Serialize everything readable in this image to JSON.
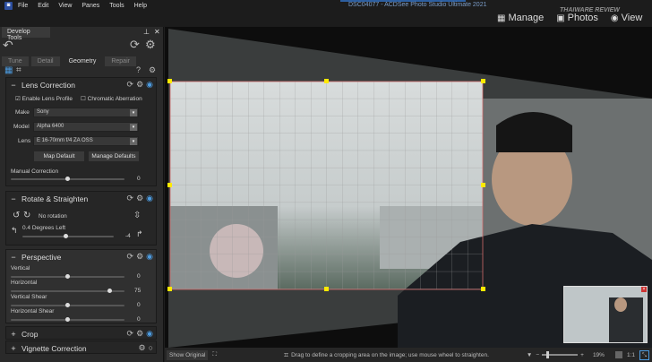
{
  "menu": [
    "File",
    "Edit",
    "View",
    "Panes",
    "Tools",
    "Help"
  ],
  "window_title": "DSC04077 - ACDSee Photo Studio Ultimate 2021",
  "modes": [
    {
      "icon": "grid-icon",
      "label": "Manage"
    },
    {
      "icon": "photos-icon",
      "label": "Photos"
    },
    {
      "icon": "eye-icon",
      "label": "View"
    }
  ],
  "watermark": "THAIWARE REVIEW",
  "panel": {
    "title": "Develop Tools",
    "tabs": [
      "Tune",
      "Detail",
      "Geometry",
      "Repair"
    ],
    "active_tab": "Geometry"
  },
  "lens": {
    "title": "Lens Correction",
    "enable_label": "Enable Lens Profile",
    "enable_checked": true,
    "chromatic_label": "Chromatic Aberration",
    "chromatic_checked": false,
    "make_label": "Make",
    "make": "Sony",
    "model_label": "Model",
    "model": "Alpha 6400",
    "lens_label": "Lens",
    "lens": "E 16-70mm f/4 ZA OSS",
    "map_default": "Map Default",
    "manage_defaults": "Manage Defaults",
    "manual_label": "Manual Correction",
    "manual_value": "0"
  },
  "rotate": {
    "title": "Rotate & Straighten",
    "rotation": "No rotation",
    "degrees_label": "0.4 Degrees Left",
    "value": "-4"
  },
  "perspective": {
    "title": "Perspective",
    "sliders": [
      {
        "label": "Vertical",
        "value": "0",
        "pos": 0.5
      },
      {
        "label": "Horizontal",
        "value": "75",
        "pos": 0.87
      },
      {
        "label": "Vertical Shear",
        "value": "0",
        "pos": 0.5
      },
      {
        "label": "Horizontal Shear",
        "value": "0",
        "pos": 0.5
      }
    ]
  },
  "crop": {
    "title": "Crop"
  },
  "vignette": {
    "title": "Vignette Correction"
  },
  "status": {
    "show_original": "Show Original",
    "hint": "Drag to define a cropping area on the image; use mouse wheel to straighten.",
    "zoom": "19%",
    "one_to_one": "1:1"
  }
}
